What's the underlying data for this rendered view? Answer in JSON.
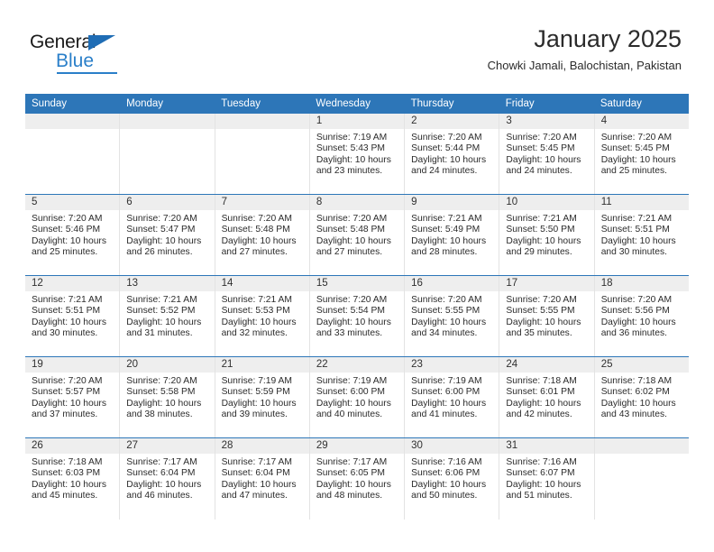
{
  "brand": {
    "name_part1": "General",
    "name_part2": "Blue",
    "triangle_icon": "triangle-icon",
    "accent_color": "#2a7fc9"
  },
  "header": {
    "title": "January 2025",
    "subtitle": "Chowki Jamali, Balochistan, Pakistan"
  },
  "theme": {
    "header_bar_color": "#2d76b8",
    "day_number_strip_color": "#eeeeee",
    "row_divider_color": "#2d76b8",
    "cell_divider_color": "#e3e3e3",
    "text_color": "#2b2b2b"
  },
  "calendar": {
    "weekday_headers": [
      "Sunday",
      "Monday",
      "Tuesday",
      "Wednesday",
      "Thursday",
      "Friday",
      "Saturday"
    ],
    "weeks": [
      [
        {
          "day": "",
          "empty": true,
          "sunrise": "",
          "sunset": "",
          "daylight1": "",
          "daylight2": ""
        },
        {
          "day": "",
          "empty": true,
          "sunrise": "",
          "sunset": "",
          "daylight1": "",
          "daylight2": ""
        },
        {
          "day": "",
          "empty": true,
          "sunrise": "",
          "sunset": "",
          "daylight1": "",
          "daylight2": ""
        },
        {
          "day": "1",
          "empty": false,
          "sunrise": "Sunrise: 7:19 AM",
          "sunset": "Sunset: 5:43 PM",
          "daylight1": "Daylight: 10 hours",
          "daylight2": "and 23 minutes."
        },
        {
          "day": "2",
          "empty": false,
          "sunrise": "Sunrise: 7:20 AM",
          "sunset": "Sunset: 5:44 PM",
          "daylight1": "Daylight: 10 hours",
          "daylight2": "and 24 minutes."
        },
        {
          "day": "3",
          "empty": false,
          "sunrise": "Sunrise: 7:20 AM",
          "sunset": "Sunset: 5:45 PM",
          "daylight1": "Daylight: 10 hours",
          "daylight2": "and 24 minutes."
        },
        {
          "day": "4",
          "empty": false,
          "sunrise": "Sunrise: 7:20 AM",
          "sunset": "Sunset: 5:45 PM",
          "daylight1": "Daylight: 10 hours",
          "daylight2": "and 25 minutes."
        }
      ],
      [
        {
          "day": "5",
          "empty": false,
          "sunrise": "Sunrise: 7:20 AM",
          "sunset": "Sunset: 5:46 PM",
          "daylight1": "Daylight: 10 hours",
          "daylight2": "and 25 minutes."
        },
        {
          "day": "6",
          "empty": false,
          "sunrise": "Sunrise: 7:20 AM",
          "sunset": "Sunset: 5:47 PM",
          "daylight1": "Daylight: 10 hours",
          "daylight2": "and 26 minutes."
        },
        {
          "day": "7",
          "empty": false,
          "sunrise": "Sunrise: 7:20 AM",
          "sunset": "Sunset: 5:48 PM",
          "daylight1": "Daylight: 10 hours",
          "daylight2": "and 27 minutes."
        },
        {
          "day": "8",
          "empty": false,
          "sunrise": "Sunrise: 7:20 AM",
          "sunset": "Sunset: 5:48 PM",
          "daylight1": "Daylight: 10 hours",
          "daylight2": "and 27 minutes."
        },
        {
          "day": "9",
          "empty": false,
          "sunrise": "Sunrise: 7:21 AM",
          "sunset": "Sunset: 5:49 PM",
          "daylight1": "Daylight: 10 hours",
          "daylight2": "and 28 minutes."
        },
        {
          "day": "10",
          "empty": false,
          "sunrise": "Sunrise: 7:21 AM",
          "sunset": "Sunset: 5:50 PM",
          "daylight1": "Daylight: 10 hours",
          "daylight2": "and 29 minutes."
        },
        {
          "day": "11",
          "empty": false,
          "sunrise": "Sunrise: 7:21 AM",
          "sunset": "Sunset: 5:51 PM",
          "daylight1": "Daylight: 10 hours",
          "daylight2": "and 30 minutes."
        }
      ],
      [
        {
          "day": "12",
          "empty": false,
          "sunrise": "Sunrise: 7:21 AM",
          "sunset": "Sunset: 5:51 PM",
          "daylight1": "Daylight: 10 hours",
          "daylight2": "and 30 minutes."
        },
        {
          "day": "13",
          "empty": false,
          "sunrise": "Sunrise: 7:21 AM",
          "sunset": "Sunset: 5:52 PM",
          "daylight1": "Daylight: 10 hours",
          "daylight2": "and 31 minutes."
        },
        {
          "day": "14",
          "empty": false,
          "sunrise": "Sunrise: 7:21 AM",
          "sunset": "Sunset: 5:53 PM",
          "daylight1": "Daylight: 10 hours",
          "daylight2": "and 32 minutes."
        },
        {
          "day": "15",
          "empty": false,
          "sunrise": "Sunrise: 7:20 AM",
          "sunset": "Sunset: 5:54 PM",
          "daylight1": "Daylight: 10 hours",
          "daylight2": "and 33 minutes."
        },
        {
          "day": "16",
          "empty": false,
          "sunrise": "Sunrise: 7:20 AM",
          "sunset": "Sunset: 5:55 PM",
          "daylight1": "Daylight: 10 hours",
          "daylight2": "and 34 minutes."
        },
        {
          "day": "17",
          "empty": false,
          "sunrise": "Sunrise: 7:20 AM",
          "sunset": "Sunset: 5:55 PM",
          "daylight1": "Daylight: 10 hours",
          "daylight2": "and 35 minutes."
        },
        {
          "day": "18",
          "empty": false,
          "sunrise": "Sunrise: 7:20 AM",
          "sunset": "Sunset: 5:56 PM",
          "daylight1": "Daylight: 10 hours",
          "daylight2": "and 36 minutes."
        }
      ],
      [
        {
          "day": "19",
          "empty": false,
          "sunrise": "Sunrise: 7:20 AM",
          "sunset": "Sunset: 5:57 PM",
          "daylight1": "Daylight: 10 hours",
          "daylight2": "and 37 minutes."
        },
        {
          "day": "20",
          "empty": false,
          "sunrise": "Sunrise: 7:20 AM",
          "sunset": "Sunset: 5:58 PM",
          "daylight1": "Daylight: 10 hours",
          "daylight2": "and 38 minutes."
        },
        {
          "day": "21",
          "empty": false,
          "sunrise": "Sunrise: 7:19 AM",
          "sunset": "Sunset: 5:59 PM",
          "daylight1": "Daylight: 10 hours",
          "daylight2": "and 39 minutes."
        },
        {
          "day": "22",
          "empty": false,
          "sunrise": "Sunrise: 7:19 AM",
          "sunset": "Sunset: 6:00 PM",
          "daylight1": "Daylight: 10 hours",
          "daylight2": "and 40 minutes."
        },
        {
          "day": "23",
          "empty": false,
          "sunrise": "Sunrise: 7:19 AM",
          "sunset": "Sunset: 6:00 PM",
          "daylight1": "Daylight: 10 hours",
          "daylight2": "and 41 minutes."
        },
        {
          "day": "24",
          "empty": false,
          "sunrise": "Sunrise: 7:18 AM",
          "sunset": "Sunset: 6:01 PM",
          "daylight1": "Daylight: 10 hours",
          "daylight2": "and 42 minutes."
        },
        {
          "day": "25",
          "empty": false,
          "sunrise": "Sunrise: 7:18 AM",
          "sunset": "Sunset: 6:02 PM",
          "daylight1": "Daylight: 10 hours",
          "daylight2": "and 43 minutes."
        }
      ],
      [
        {
          "day": "26",
          "empty": false,
          "sunrise": "Sunrise: 7:18 AM",
          "sunset": "Sunset: 6:03 PM",
          "daylight1": "Daylight: 10 hours",
          "daylight2": "and 45 minutes."
        },
        {
          "day": "27",
          "empty": false,
          "sunrise": "Sunrise: 7:17 AM",
          "sunset": "Sunset: 6:04 PM",
          "daylight1": "Daylight: 10 hours",
          "daylight2": "and 46 minutes."
        },
        {
          "day": "28",
          "empty": false,
          "sunrise": "Sunrise: 7:17 AM",
          "sunset": "Sunset: 6:04 PM",
          "daylight1": "Daylight: 10 hours",
          "daylight2": "and 47 minutes."
        },
        {
          "day": "29",
          "empty": false,
          "sunrise": "Sunrise: 7:17 AM",
          "sunset": "Sunset: 6:05 PM",
          "daylight1": "Daylight: 10 hours",
          "daylight2": "and 48 minutes."
        },
        {
          "day": "30",
          "empty": false,
          "sunrise": "Sunrise: 7:16 AM",
          "sunset": "Sunset: 6:06 PM",
          "daylight1": "Daylight: 10 hours",
          "daylight2": "and 50 minutes."
        },
        {
          "day": "31",
          "empty": false,
          "sunrise": "Sunrise: 7:16 AM",
          "sunset": "Sunset: 6:07 PM",
          "daylight1": "Daylight: 10 hours",
          "daylight2": "and 51 minutes."
        },
        {
          "day": "",
          "empty": true,
          "sunrise": "",
          "sunset": "",
          "daylight1": "",
          "daylight2": ""
        }
      ]
    ]
  }
}
